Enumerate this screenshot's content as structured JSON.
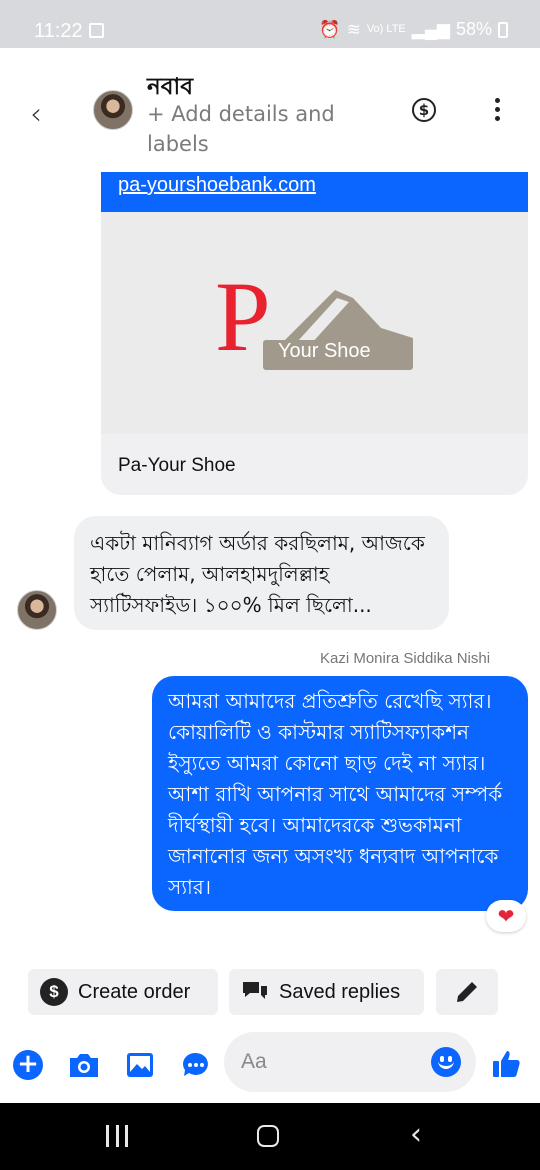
{
  "status_bar": {
    "time": "11:22",
    "network": "Vo) LTE",
    "battery": "58%"
  },
  "header": {
    "back_icon": "chevron-left-icon",
    "contact_name": "নবাব",
    "contact_subtitle": "+ Add details and labels",
    "dollar_icon": "dollar-circle-icon",
    "more_icon": "more-vertical-icon"
  },
  "link_card": {
    "url": "pa-yourshoebank.com",
    "logo_letter": "P",
    "logo_text": "Your Shoe",
    "title": "Pa-Your Shoe"
  },
  "messages": {
    "incoming_text": "একটা মানিব্যাগ অর্ডার করছিলাম, আজকে হাতে পেলাম, আলহামদুলিল্লাহ স্যাটিসফাইড। ১০০% মিল ছিলো...",
    "sender_name": "Kazi Monira Siddika Nishi",
    "outgoing_text": "আমরা আমাদের প্রতিশ্রুতি রেখেছি স্যার। কোয়ালিটি ও কাস্টমার স্যাটিসফ্যাকশন ইস্যুতে আমরা কোনো ছাড় দেই না স্যার। আশা রাখি আপনার সাথে আমাদের সম্পর্ক দীর্ঘস্থায়ী হবে। আমাদেরকে শুভকামনা জানানোর জন্য অসংখ্য ধন্যবাদ আপনাকে স্যার।",
    "reaction": "❤"
  },
  "quick_actions": {
    "create_order": "Create order",
    "saved_replies": "Saved replies",
    "edit_icon": "pencil-icon"
  },
  "composer": {
    "placeholder": "Aa",
    "icons": [
      "plus-icon",
      "camera-icon",
      "image-icon",
      "chat-bubble-icon",
      "emoji-icon",
      "thumbs-up-icon"
    ]
  },
  "colors": {
    "accent": "#0b66ff",
    "bubble_in": "#eef0f2",
    "logo_red": "#e8222f",
    "logo_gray": "#a19a8c"
  }
}
